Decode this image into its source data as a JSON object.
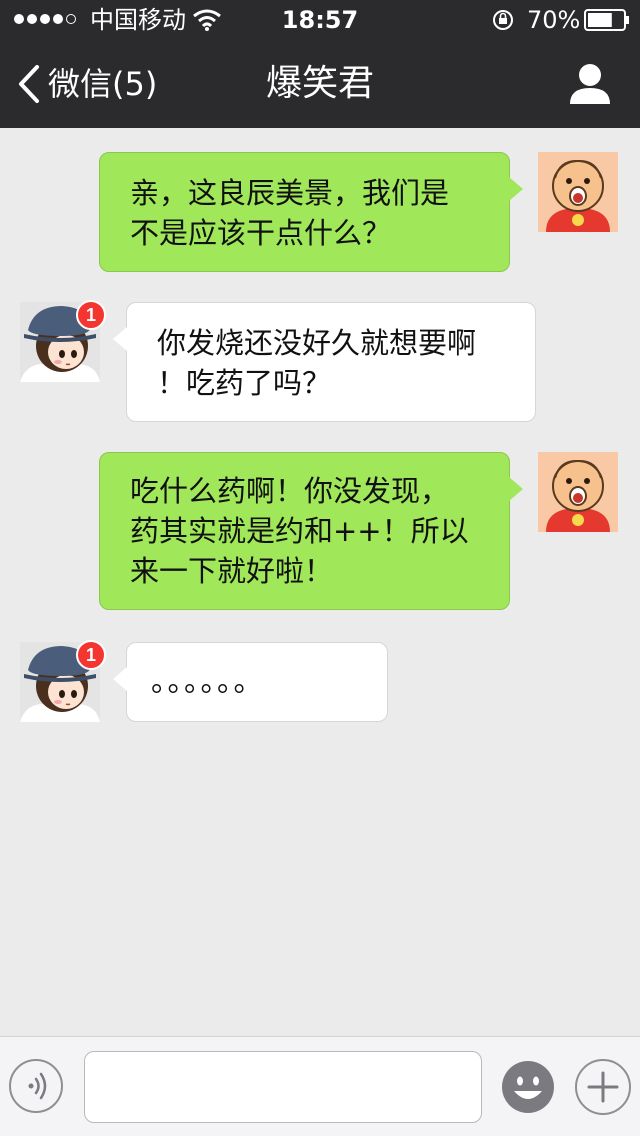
{
  "status_bar": {
    "carrier": "中国移动",
    "time": "18:57",
    "battery_percent": "70%",
    "signal_bars_filled": 4,
    "signal_bars_total": 5,
    "battery_level": 0.7
  },
  "nav": {
    "back_label": "微信(5)",
    "title": "爆笑君",
    "back_icon": "chevron-left-icon",
    "profile_icon": "person-icon"
  },
  "messages": [
    {
      "sender": "me",
      "lines": [
        "亲，这良辰美景，我们是",
        "不是应该干点什么？"
      ]
    },
    {
      "sender": "other",
      "badge": "1",
      "lines": [
        "你发烧还没好久就想要啊",
        "！吃药了吗？"
      ]
    },
    {
      "sender": "me",
      "lines": [
        "吃什么药啊！你没发现，",
        "药其实就是约和++！所以",
        "来一下就好啦！"
      ]
    },
    {
      "sender": "other",
      "badge": "1",
      "lines": [
        "。。。。。。"
      ]
    }
  ],
  "input_bar": {
    "voice_icon": "voice-icon",
    "text_value": "",
    "emoji_icon": "emoji-icon",
    "plus_icon": "plus-icon"
  },
  "colors": {
    "nav_background": "#2b2b2e",
    "chat_background": "#ebebeb",
    "my_bubble": "#a0e75a",
    "other_bubble": "#ffffff",
    "badge": "#f43530"
  }
}
